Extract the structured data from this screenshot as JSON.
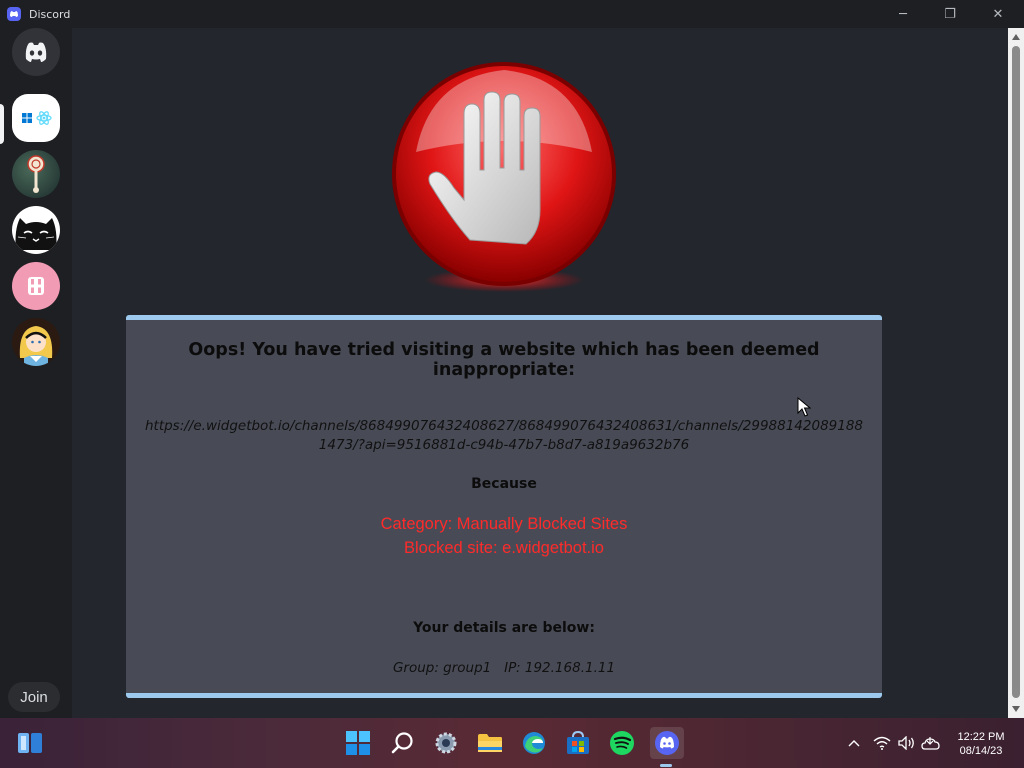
{
  "window": {
    "title": "Discord",
    "controls": {
      "minimize": "─",
      "maximize": "❐",
      "close": "✕"
    }
  },
  "sidebar": {
    "home_icon": "discord-logo-icon",
    "servers": [
      {
        "name": "windows-react-server",
        "icon": "windows-react-icon",
        "selected": true
      },
      {
        "name": "lollipop-server",
        "icon": "lollipop-avatar"
      },
      {
        "name": "black-cat-server",
        "icon": "black-cat-avatar"
      },
      {
        "name": "pink-h-server",
        "icon": "pink-h-avatar"
      },
      {
        "name": "alice-server",
        "icon": "alice-avatar"
      }
    ],
    "join_label": "Join"
  },
  "block_page": {
    "icon": "stop-hand-icon",
    "title": "Oops! You have tried visiting a website which has been deemed inappropriate:",
    "url_line1": "https://e.widgetbot.io/channels/868499076432408627/868499076432408631/channels/29988142089188",
    "url_line2": "1473/?api=9516881d-c94b-47b7-b8d7-a819a9632b76",
    "because": "Because",
    "category": "Category: Manually Blocked Sites",
    "blocked_site": "Blocked site: e.widgetbot.io",
    "details_heading": "Your details are below:",
    "group_ip": "Group: group1   IP: 192.168.1.11"
  },
  "taskbar": {
    "icons": [
      "widgets-icon",
      "start-icon",
      "search-icon",
      "settings-icon",
      "file-explorer-icon",
      "edge-icon",
      "store-icon",
      "spotify-icon",
      "discord-icon"
    ],
    "tray": [
      "chevron-up-icon",
      "wifi-icon",
      "volume-icon",
      "cloud-icon"
    ],
    "time": "12:22 PM",
    "date": "08/14/23"
  },
  "colors": {
    "accent": "#5865f2",
    "box_border": "#9ec9ef",
    "reason_red": "#ff2a2a"
  }
}
